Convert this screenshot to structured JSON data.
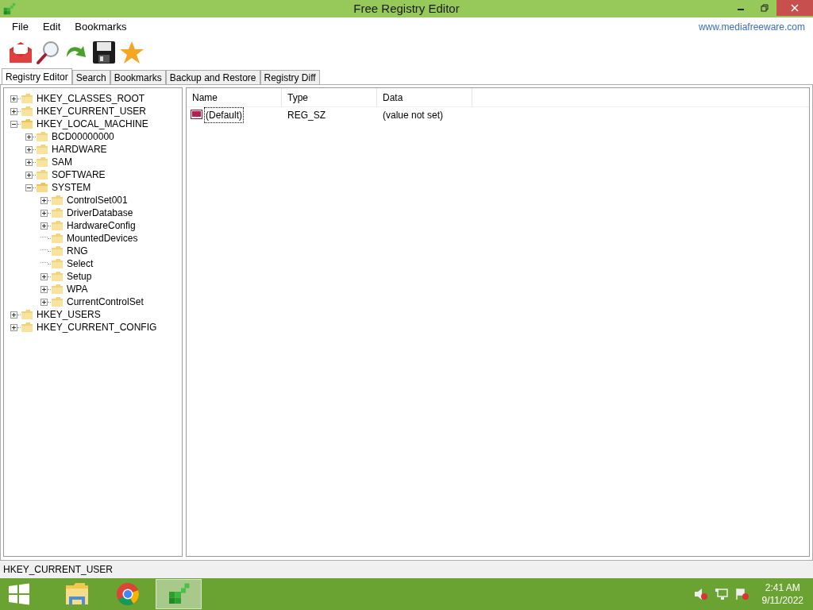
{
  "window": {
    "title": "Free Registry Editor"
  },
  "menu": [
    "File",
    "Edit",
    "Bookmarks"
  ],
  "website_link": "www.mediafreeware.com",
  "toolbar": [
    {
      "kind": "mail"
    },
    {
      "kind": "search"
    },
    {
      "kind": "refresh"
    },
    {
      "kind": "save"
    },
    {
      "kind": "star"
    }
  ],
  "tabs": [
    {
      "label": "Registry Editor",
      "selected": true
    },
    {
      "label": "Search",
      "selected": false
    },
    {
      "label": "Bookmarks",
      "selected": false
    },
    {
      "label": "Backup and Restore",
      "selected": false
    },
    {
      "label": "Registry Diff",
      "selected": false
    }
  ],
  "tree": [
    {
      "label": "HKEY_CLASSES_ROOT",
      "expanded": false
    },
    {
      "label": "HKEY_CURRENT_USER",
      "expanded": false
    },
    {
      "label": "HKEY_LOCAL_MACHINE",
      "expanded": true,
      "children": [
        {
          "label": "BCD00000000",
          "expanded": false
        },
        {
          "label": "HARDWARE",
          "expanded": false
        },
        {
          "label": "SAM",
          "expanded": false
        },
        {
          "label": "SOFTWARE",
          "expanded": false
        },
        {
          "label": "SYSTEM",
          "expanded": true,
          "children": [
            {
              "label": "ControlSet001",
              "expanded": false
            },
            {
              "label": "DriverDatabase",
              "expanded": false
            },
            {
              "label": "HardwareConfig",
              "expanded": false
            },
            {
              "label": "MountedDevices"
            },
            {
              "label": "RNG"
            },
            {
              "label": "Select"
            },
            {
              "label": "Setup",
              "expanded": false
            },
            {
              "label": "WPA",
              "expanded": false
            },
            {
              "label": "CurrentControlSet",
              "expanded": false
            }
          ]
        }
      ]
    },
    {
      "label": "HKEY_USERS",
      "expanded": false
    },
    {
      "label": "HKEY_CURRENT_CONFIG",
      "expanded": false
    }
  ],
  "values_table": {
    "columns": [
      "Name",
      "Type",
      "Data"
    ],
    "rows": [
      {
        "name": "(Default)",
        "type": "REG_SZ",
        "data": "(value not set)",
        "focused": true
      }
    ]
  },
  "status_bar": "HKEY_CURRENT_USER",
  "taskbar": {
    "apps": [
      {
        "kind": "explorer",
        "selected": false
      },
      {
        "kind": "chrome",
        "selected": false
      },
      {
        "kind": "registry",
        "selected": true
      }
    ],
    "time": "2:41 AM",
    "date": "9/11/2022"
  }
}
